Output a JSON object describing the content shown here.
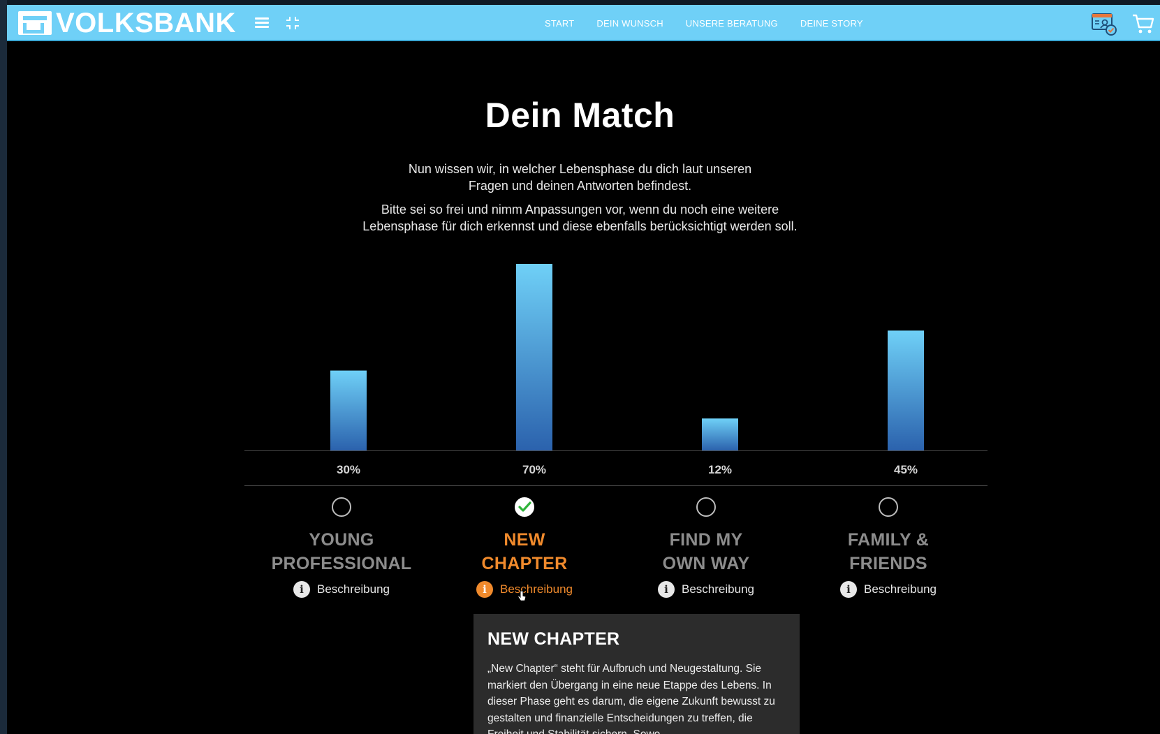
{
  "header": {
    "brand": "VOLKSBANK",
    "nav": [
      "START",
      "DEIN WUNSCH",
      "UNSERE BERATUNG",
      "DEINE STORY"
    ],
    "colors": {
      "bar": "#6fd0f7",
      "accent": "#f08a2c"
    },
    "icons": [
      "menu-icon",
      "collapse-icon",
      "profile-card-icon",
      "cart-icon"
    ]
  },
  "main": {
    "title": "Dein Match",
    "intro_1a": "Nun wissen wir, in welcher Lebensphase du dich laut unseren",
    "intro_1b": "Fragen und deinen Antworten befindest.",
    "intro_2a": "Bitte sei so frei und nimm Anpassungen vor, wenn du noch eine weitere",
    "intro_2b": "Lebensphase für dich erkennst und diese ebenfalls berücksichtigt werden soll."
  },
  "phases": [
    {
      "line1": "YOUNG",
      "line2": "PROFESSIONAL",
      "percent": "30%",
      "selected": false,
      "desc_label": "Beschreibung"
    },
    {
      "line1": "NEW",
      "line2": "CHAPTER",
      "percent": "70%",
      "selected": true,
      "desc_label": "Beschreibung"
    },
    {
      "line1": "FIND MY",
      "line2": "OWN WAY",
      "percent": "12%",
      "selected": false,
      "desc_label": "Beschreibung"
    },
    {
      "line1": "FAMILY &",
      "line2": "FRIENDS",
      "percent": "45%",
      "selected": false,
      "desc_label": "Beschreibung"
    }
  ],
  "chart_data": {
    "type": "bar",
    "categories": [
      "YOUNG PROFESSIONAL",
      "NEW CHAPTER",
      "FIND MY OWN WAY",
      "FAMILY & FRIENDS"
    ],
    "values": [
      30,
      70,
      12,
      45
    ],
    "unit": "%",
    "ylim": [
      0,
      70
    ]
  },
  "popup": {
    "title": "NEW CHAPTER",
    "body": "„New Chapter“ steht für Aufbruch und Neugestaltung. Sie markiert den Übergang in eine neue Etappe des Lebens. In dieser Phase geht es darum, die eigene Zukunft bewusst zu gestalten und finanzielle Entscheidungen zu treffen, die Freiheit und Stabilität sichern. Sowo"
  }
}
